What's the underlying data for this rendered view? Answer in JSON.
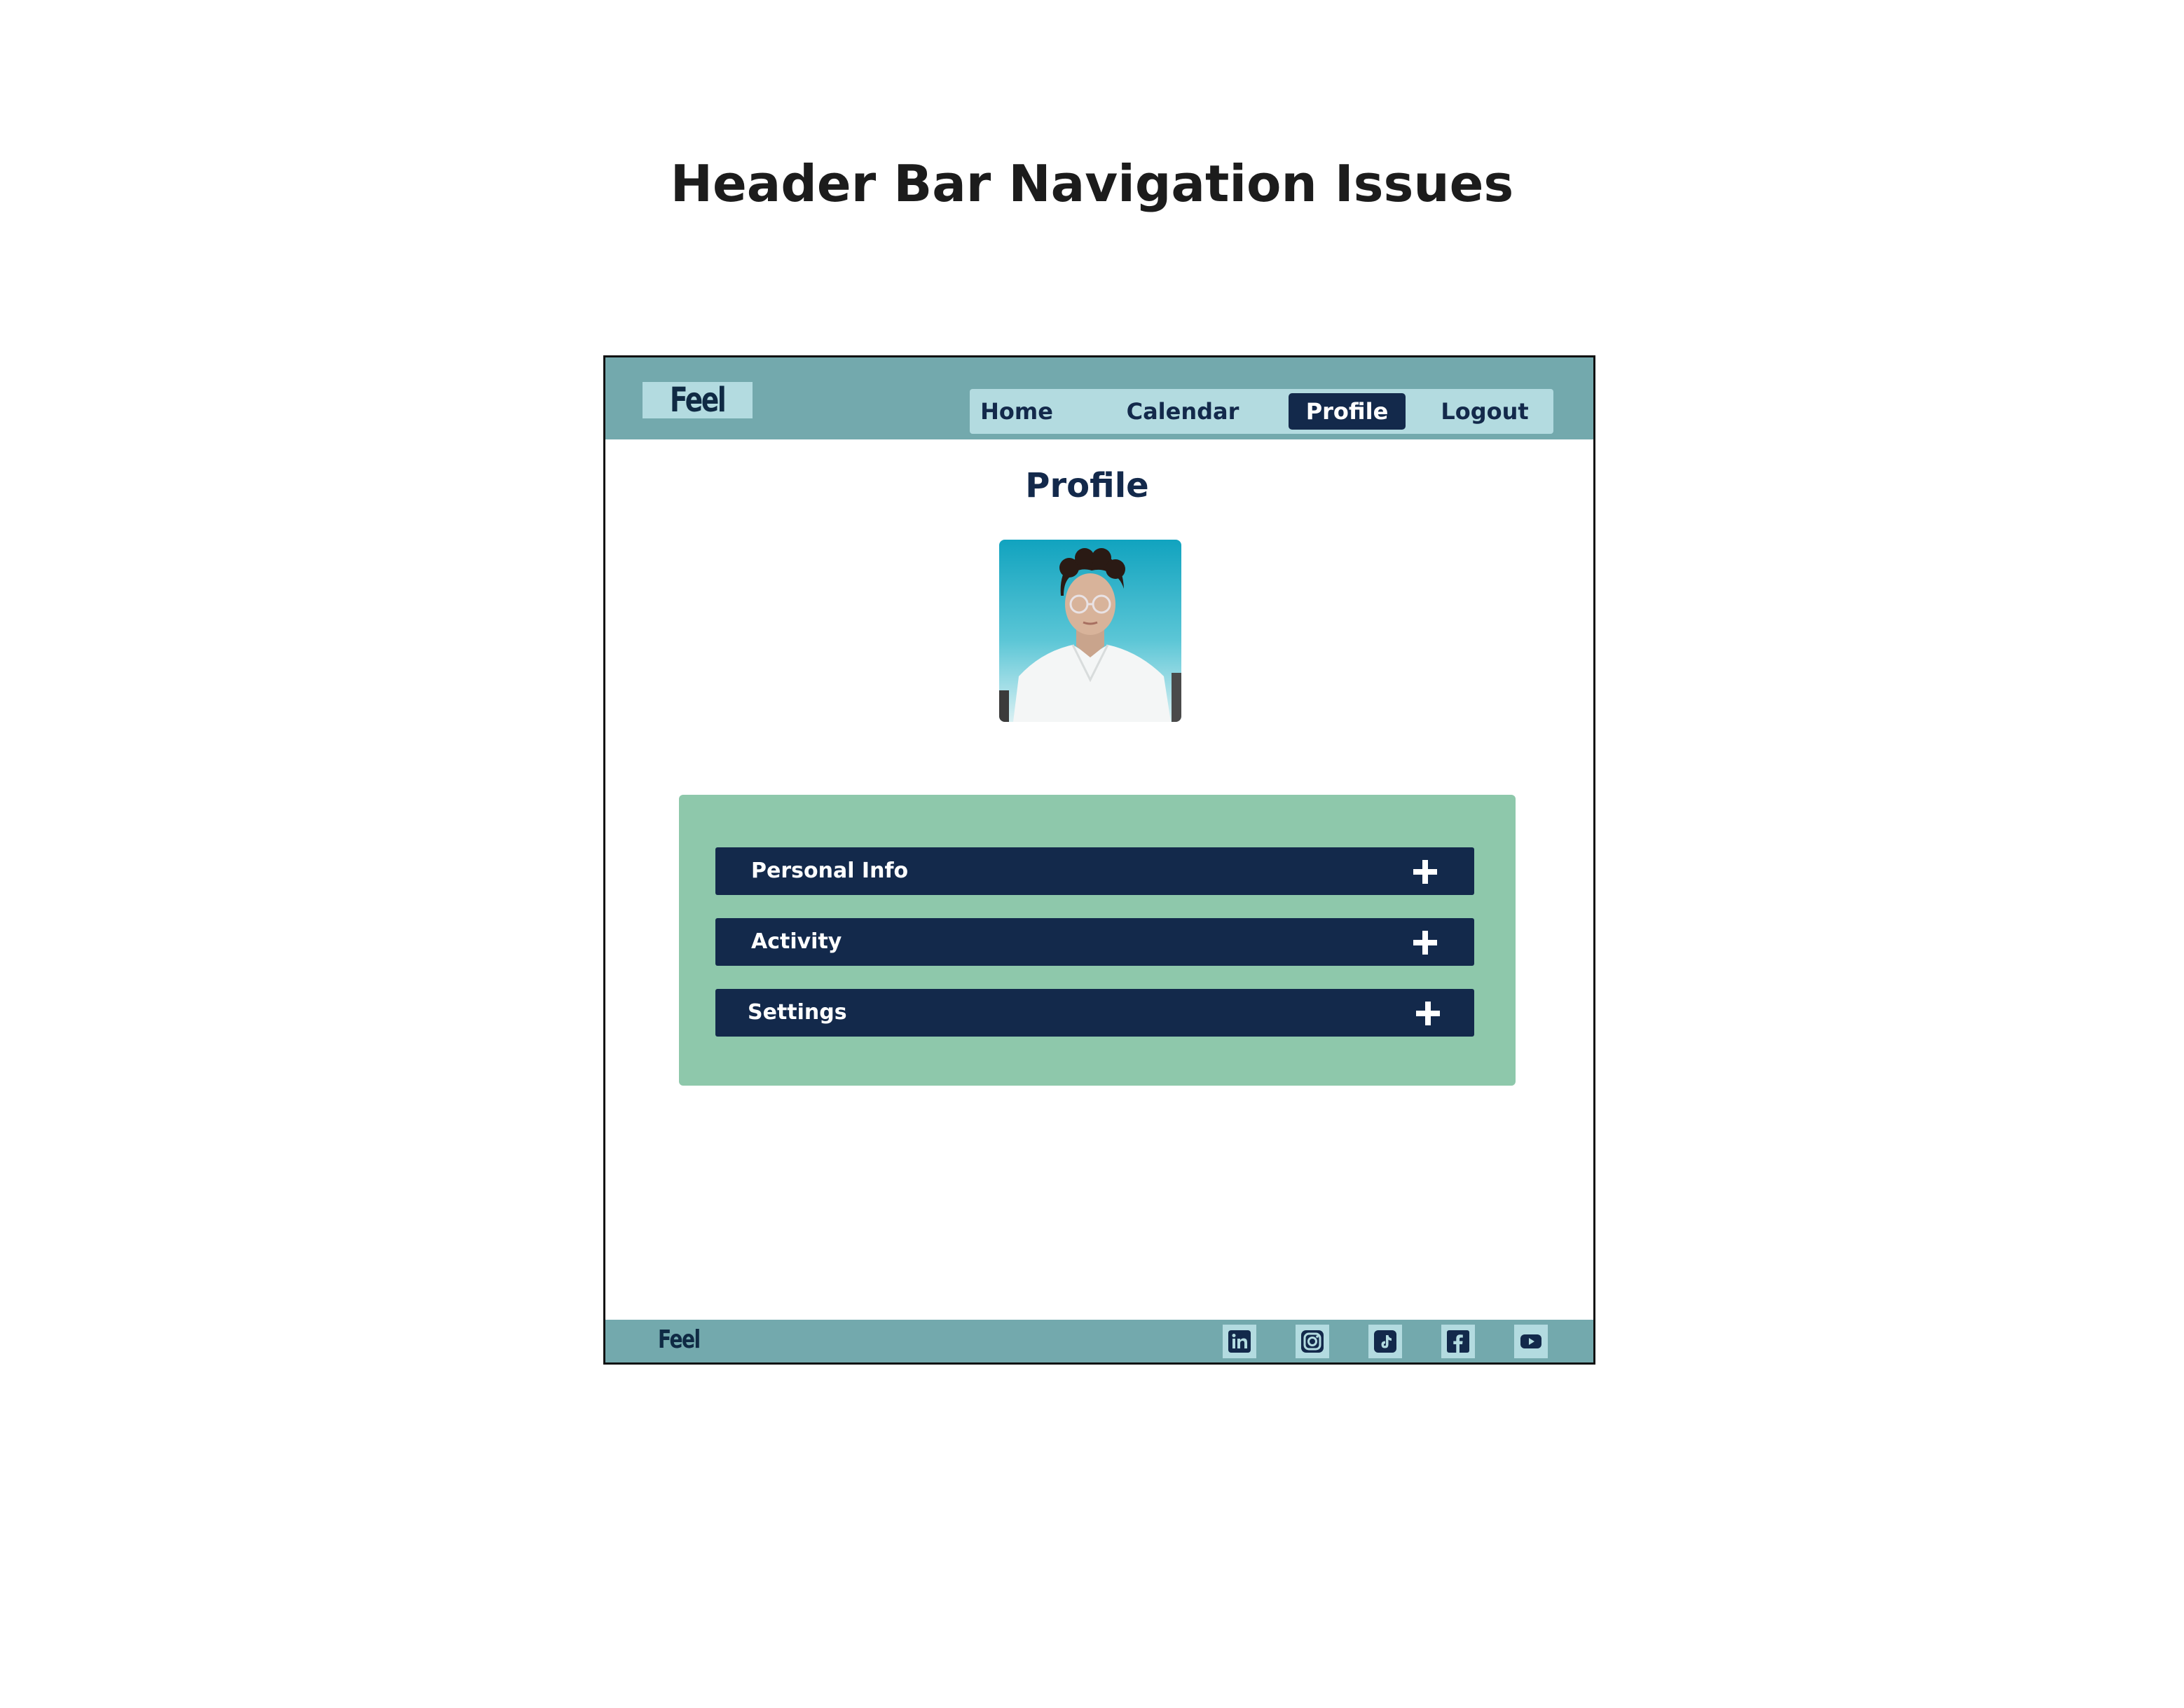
{
  "page": {
    "heading": "Header Bar Navigation Issues"
  },
  "header": {
    "logo": "Feel",
    "nav": [
      {
        "label": "Home",
        "active": false
      },
      {
        "label": "Calendar",
        "active": false
      },
      {
        "label": "Profile",
        "active": true
      },
      {
        "label": "Logout",
        "active": false
      }
    ]
  },
  "main": {
    "title": "Profile",
    "accordion": [
      {
        "label": "Personal Info",
        "icon": "plus-icon"
      },
      {
        "label": "Activity",
        "icon": "plus-icon"
      },
      {
        "label": "Settings",
        "icon": "plus-icon"
      }
    ]
  },
  "footer": {
    "logo": "Feel",
    "social": [
      "linkedin-icon",
      "instagram-icon",
      "tiktok-icon",
      "facebook-icon",
      "youtube-icon"
    ]
  },
  "colors": {
    "header_bg": "#73a9ad",
    "nav_bg": "#b3dbe0",
    "navy": "#13294b",
    "panel_green": "#8ec8ab"
  }
}
